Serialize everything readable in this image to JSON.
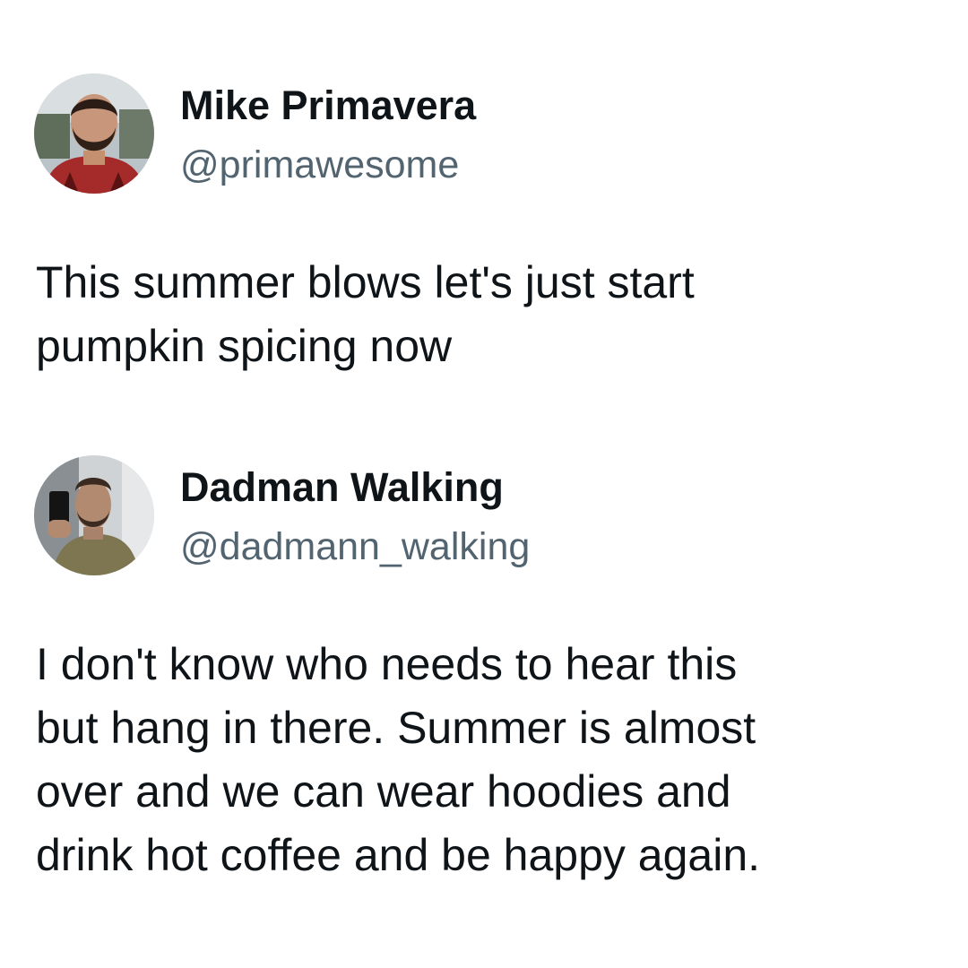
{
  "tweets": [
    {
      "display_name": "Mike Primavera",
      "handle": "@primawesome",
      "text_lines": [
        "This summer blows let's just start",
        "pumpkin spicing now"
      ]
    },
    {
      "display_name": "Dadman Walking",
      "handle": "@dadmann_walking",
      "text_lines": [
        "I don't know who needs to hear this",
        "but hang in there. Summer is almost",
        "over and we can wear hoodies and",
        "drink hot coffee and be happy again."
      ]
    }
  ],
  "colors": {
    "text": "#0f1419",
    "handle": "#536471",
    "background": "#ffffff"
  }
}
